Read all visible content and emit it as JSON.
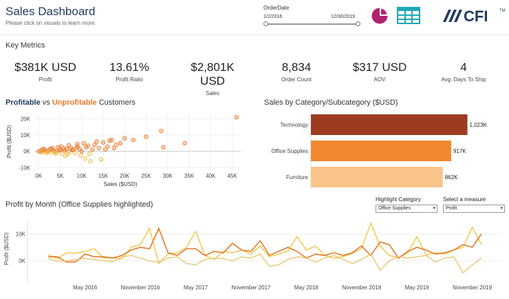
{
  "header": {
    "title": "Sales Dashboard",
    "subtitle": "Please click on visuals to learn more.",
    "order_date": {
      "label": "OrderDate",
      "start": "1/2/2016",
      "end": "12/30/2019"
    },
    "logo_text": "CFI",
    "logo_tm": "TM"
  },
  "colors": {
    "navy": "#1f3a5f",
    "orange": "#e8782a",
    "bar_technology": "#9c3b1f",
    "bar_office": "#f0892f",
    "bar_furniture": "#f9c48a",
    "pie_icon": "#b0246f",
    "table_icon": "#1ea8b5"
  },
  "icons": [
    "pie-chart-icon",
    "table-icon",
    "cfi-logo"
  ],
  "key_metrics": {
    "title": "Key Metrics",
    "items": [
      {
        "value": "$381K USD",
        "label": "Profit"
      },
      {
        "value": "13.61%",
        "label": "Profit Ratio"
      },
      {
        "value": "$2,801K USD",
        "label": "Sales"
      },
      {
        "value": "8,834",
        "label": "Order Count"
      },
      {
        "value": "$317 USD",
        "label": "AOV"
      },
      {
        "value": "4",
        "label": "Avg. Days To Ship"
      }
    ]
  },
  "scatter": {
    "title_part1": "Profitable",
    "title_part2": " vs ",
    "title_part3": "Unprofitable",
    "title_part4": " Customers"
  },
  "category_bars": {
    "title": "Sales by Category/Subcategory ($USD)"
  },
  "monthly": {
    "title": "Profit by Month (Office Supplies highlighted)",
    "highlight_label": "Highlight Category",
    "highlight_value": "Office Supplies",
    "measure_label": "Select a measure",
    "measure_value": "Profit"
  },
  "chart_data": [
    {
      "type": "scatter",
      "xlabel": "Sales ($USD)",
      "ylabel": "Profit ($USD)",
      "xlim": [
        -1000,
        47000
      ],
      "ylim": [
        -12000,
        24000
      ],
      "x_ticks": [
        "0K",
        "5K",
        "10K",
        "15K",
        "20K",
        "25K",
        "30K",
        "35K",
        "40K",
        "45K"
      ],
      "y_ticks": [
        "20K",
        "10K",
        "0K",
        "-10K"
      ],
      "points": [
        [
          46000,
          21000
        ],
        [
          28500,
          12500
        ],
        [
          34000,
          5000
        ],
        [
          25000,
          9000
        ],
        [
          29000,
          2500
        ],
        [
          22000,
          7000
        ],
        [
          20000,
          8000
        ],
        [
          19000,
          5000
        ],
        [
          17000,
          7000
        ],
        [
          18000,
          4000
        ],
        [
          16000,
          3000
        ],
        [
          15000,
          5500
        ],
        [
          14000,
          2000
        ],
        [
          13000,
          4000
        ],
        [
          12500,
          1000
        ],
        [
          11000,
          2500
        ],
        [
          10500,
          5000
        ],
        [
          10000,
          0
        ],
        [
          9500,
          1500
        ],
        [
          9000,
          3000
        ],
        [
          8500,
          -1000
        ],
        [
          8000,
          1000
        ],
        [
          7500,
          2000
        ],
        [
          7000,
          -500
        ],
        [
          6500,
          1500
        ],
        [
          6000,
          500
        ],
        [
          5500,
          -1500
        ],
        [
          5000,
          1000
        ],
        [
          4500,
          2500
        ],
        [
          4000,
          0
        ],
        [
          3500,
          500
        ],
        [
          3000,
          -500
        ],
        [
          2500,
          1000
        ],
        [
          2000,
          0
        ],
        [
          1500,
          500
        ],
        [
          1000,
          -200
        ],
        [
          500,
          200
        ],
        [
          0,
          0
        ],
        [
          800,
          1200
        ],
        [
          1800,
          -800
        ],
        [
          2800,
          1500
        ],
        [
          3800,
          -1200
        ],
        [
          4800,
          600
        ],
        [
          5800,
          1800
        ],
        [
          6800,
          -1800
        ],
        [
          7800,
          800
        ],
        [
          8800,
          2200
        ],
        [
          9800,
          -2500
        ],
        [
          10800,
          -4500
        ],
        [
          12000,
          -6000
        ],
        [
          14500,
          -5000
        ],
        [
          11500,
          3500
        ],
        [
          13500,
          6000
        ],
        [
          16500,
          6500
        ],
        [
          9000,
          4500
        ],
        [
          7000,
          3800
        ],
        [
          5200,
          3000
        ],
        [
          3200,
          2000
        ],
        [
          1200,
          1500
        ],
        [
          600,
          -600
        ],
        [
          15500,
          1200
        ],
        [
          17500,
          2000
        ],
        [
          11800,
          -1500
        ],
        [
          6200,
          -2800
        ],
        [
          4200,
          -1000
        ],
        [
          2200,
          -300
        ]
      ]
    },
    {
      "type": "bar",
      "orientation": "horizontal",
      "categories": [
        "Technology",
        "Office Supplies",
        "Furniture"
      ],
      "values": [
        1023,
        917,
        862
      ],
      "value_labels": [
        "1,023K",
        "917K",
        "862K"
      ],
      "xlim": [
        0,
        1070
      ]
    },
    {
      "type": "line",
      "ylabel": "Profit ($USD)",
      "y_ticks": [
        "10K",
        "0K"
      ],
      "ylim": [
        -6000,
        15000
      ],
      "x_tick_labels": [
        "May 2016",
        "November 2016",
        "May 2017",
        "November 2017",
        "May 2018",
        "November 2018",
        "May 2019",
        "November 2019"
      ],
      "x_tick_indices": [
        4,
        10,
        16,
        22,
        28,
        34,
        40,
        46
      ],
      "months": 48,
      "series": [
        {
          "color": "#f0c233",
          "values": [
            2200,
            900,
            3000,
            2800,
            3500,
            4500,
            1000,
            1200,
            600,
            5000,
            6000,
            12000,
            -1000,
            2500,
            3000,
            5000,
            11000,
            2000,
            500,
            3500,
            3000,
            4000,
            2500,
            5500,
            1500,
            2500,
            3500,
            9000,
            4000,
            5500,
            2000,
            1000,
            1500,
            2800,
            4500,
            14000,
            5500,
            2000,
            1200,
            3000,
            9000,
            2200,
            3000,
            2500,
            4000,
            5000,
            12500,
            6000
          ]
        },
        {
          "color": "#e07b2a",
          "values": [
            1500,
            1500,
            -500,
            -400,
            2500,
            1500,
            1500,
            1000,
            2000,
            4000,
            5000,
            4500,
            12000,
            3000,
            2000,
            4500,
            4500,
            2000,
            3500,
            3000,
            6500,
            4000,
            3500,
            7500,
            2000,
            3500,
            5000,
            3500,
            1000,
            2500,
            2000,
            3000,
            2000,
            3000,
            5500,
            2000,
            7000,
            6000,
            1000,
            3500,
            5000,
            4000,
            2500,
            3000,
            4000,
            6000,
            5000,
            10000
          ]
        },
        {
          "color": "#e8c46a",
          "values": [
            800,
            -200,
            0,
            500,
            800,
            500,
            0,
            -300,
            1500,
            2000,
            1000,
            0,
            -500,
            1000,
            1500,
            -1000,
            -1500,
            500,
            1000,
            800,
            0,
            1500,
            1000,
            2500,
            -2000,
            -1500,
            500,
            1500,
            1000,
            -500,
            1000,
            2000,
            500,
            -1000,
            500,
            2500,
            -3500,
            0,
            1500,
            1000,
            1500,
            2000,
            -500,
            1000,
            1500,
            -4500,
            -1500,
            1000
          ]
        }
      ]
    }
  ]
}
